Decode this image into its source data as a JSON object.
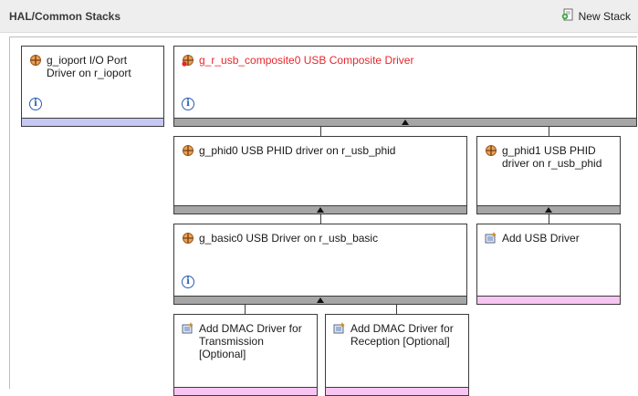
{
  "header": {
    "title": "HAL/Common Stacks",
    "new_stack_label": "New Stack"
  },
  "modules": {
    "ioport": {
      "label": "g_ioport I/O Port Driver on r_ioport"
    },
    "composite": {
      "label": "g_r_usb_composite0 USB Composite Driver"
    },
    "phid0": {
      "label": "g_phid0 USB PHID driver on r_usb_phid"
    },
    "phid1": {
      "label": "g_phid1 USB PHID driver on r_usb_phid"
    },
    "basic0": {
      "label": "g_basic0 USB Driver on r_usb_basic"
    },
    "add_usb": {
      "label": "Add USB Driver"
    },
    "add_dmac_tx": {
      "label": "Add DMAC Driver for Transmission [Optional]"
    },
    "add_dmac_rx": {
      "label": "Add DMAC Driver for Reception [Optional]"
    }
  },
  "info_symbol": "i",
  "colors": {
    "error_text": "#e8262c",
    "bar_gray": "#a6a6a6",
    "bar_lavender": "#c7c7f5",
    "bar_pink": "#f7c5f1",
    "info_blue": "#2a5db0"
  }
}
